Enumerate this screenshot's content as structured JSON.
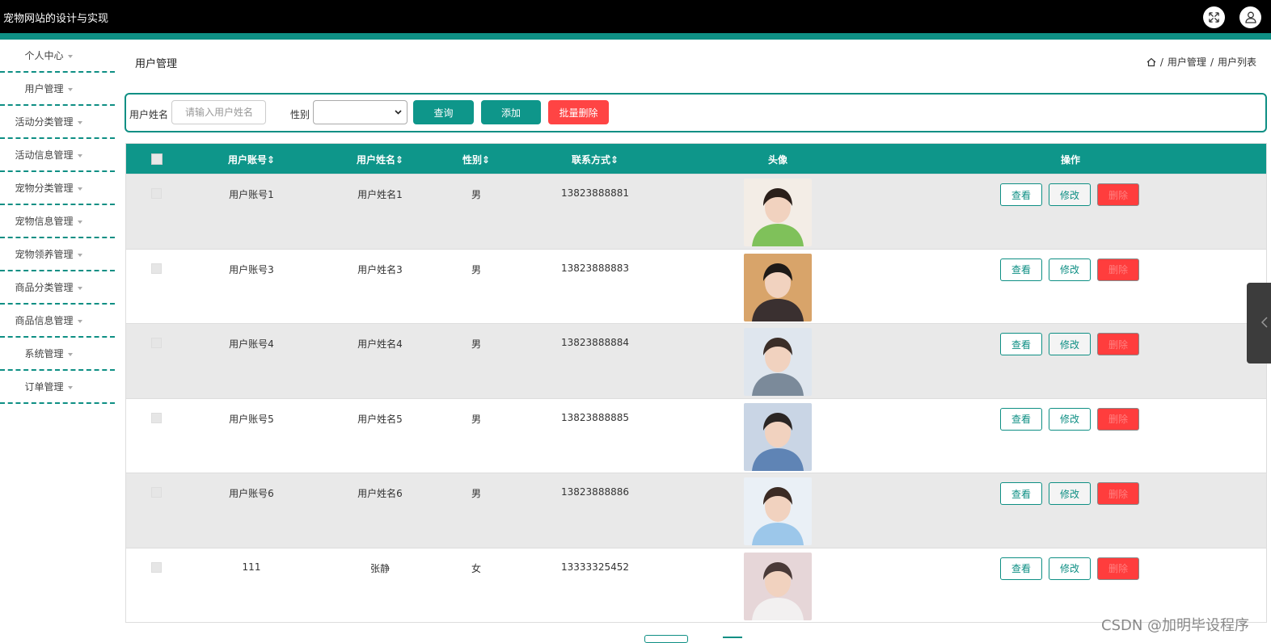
{
  "app": {
    "title": "宠物网站的设计与实现"
  },
  "header_icons": [
    "fullscreen-icon",
    "user-icon"
  ],
  "sidebar": {
    "items": [
      {
        "label": "个人中心"
      },
      {
        "label": "用户管理"
      },
      {
        "label": "活动分类管理"
      },
      {
        "label": "活动信息管理"
      },
      {
        "label": "宠物分类管理"
      },
      {
        "label": "宠物信息管理"
      },
      {
        "label": "宠物领养管理"
      },
      {
        "label": "商品分类管理"
      },
      {
        "label": "商品信息管理"
      },
      {
        "label": "系统管理"
      },
      {
        "label": "订单管理"
      }
    ]
  },
  "page": {
    "title": "用户管理",
    "breadcrumb": [
      "用户管理",
      "用户列表"
    ]
  },
  "search": {
    "name_label": "用户姓名",
    "name_placeholder": "请输入用户姓名",
    "name_value": "",
    "gender_label": "性别",
    "gender_value": "",
    "query_button": "查询",
    "add_button": "添加",
    "batch_delete_button": "批量删除"
  },
  "table": {
    "columns": [
      "用户账号",
      "用户姓名",
      "性别",
      "联系方式",
      "头像",
      "操作"
    ],
    "sort_glyph": "⇕",
    "actions": {
      "view": "查看",
      "edit": "修改",
      "delete": "删除"
    },
    "rows": [
      {
        "account": "用户账号1",
        "name": "用户姓名1",
        "gender": "男",
        "phone": "13823888881"
      },
      {
        "account": "用户账号3",
        "name": "用户姓名3",
        "gender": "男",
        "phone": "13823888883"
      },
      {
        "account": "用户账号4",
        "name": "用户姓名4",
        "gender": "男",
        "phone": "13823888884"
      },
      {
        "account": "用户账号5",
        "name": "用户姓名5",
        "gender": "男",
        "phone": "13823888885"
      },
      {
        "account": "用户账号6",
        "name": "用户姓名6",
        "gender": "男",
        "phone": "13823888886"
      },
      {
        "account": "111",
        "name": "张静",
        "gender": "女",
        "phone": "13333325452"
      }
    ]
  },
  "colors": {
    "accent": "#0e8f84",
    "danger": "#ff4444",
    "topbar": "#000000"
  },
  "watermark": "CSDN @加明毕设程序"
}
